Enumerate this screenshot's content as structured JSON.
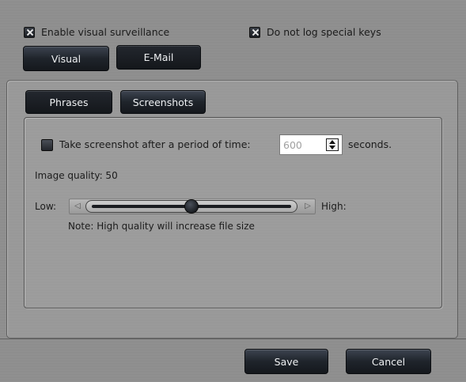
{
  "options": {
    "enable_visual_surveillance": {
      "label": "Enable visual surveillance",
      "checked": true
    },
    "do_not_log_special_keys": {
      "label": "Do not log special keys",
      "checked": true
    }
  },
  "main_tabs": [
    {
      "label": "Visual",
      "selected": true
    },
    {
      "label": "E-Mail",
      "selected": false
    }
  ],
  "sub_tabs": [
    {
      "label": "Phrases",
      "selected": false
    },
    {
      "label": "Screenshots",
      "selected": true
    }
  ],
  "screenshots": {
    "take_screenshot": {
      "label": "Take screenshot after a period of time:",
      "checked": false
    },
    "period": {
      "value": "600",
      "unit_label": "seconds."
    },
    "image_quality_label": "Image quality: 50",
    "quality": {
      "value": 50,
      "min": 0,
      "max": 100
    },
    "slider_low_label": "Low:",
    "slider_high_label": "High:",
    "note": "Note: High quality will increase file size"
  },
  "footer": {
    "save_label": "Save",
    "cancel_label": "Cancel"
  },
  "icons": {
    "checkbox_checked": "x-mark-icon",
    "spinner": "up-down-arrows-icon",
    "slider_left": "volume-low-icon",
    "slider_right": "volume-high-icon"
  }
}
